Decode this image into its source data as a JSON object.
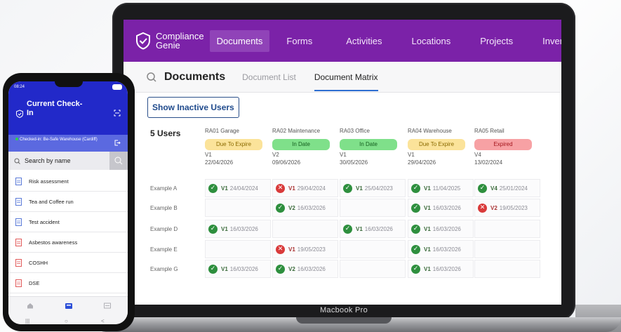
{
  "laptop": {
    "model_label": "Macbook Pro"
  },
  "app": {
    "brand": {
      "line1": "Compliance",
      "line2": "Genie"
    },
    "nav": [
      {
        "label": "Documents",
        "active": true
      },
      {
        "label": "Forms",
        "active": false
      },
      {
        "label": "Activities",
        "active": false
      },
      {
        "label": "Locations",
        "active": false
      },
      {
        "label": "Projects",
        "active": false
      },
      {
        "label": "Inventory",
        "active": false
      }
    ],
    "subheader": {
      "title": "Documents",
      "tabs": [
        {
          "label": "Document List",
          "active": false
        },
        {
          "label": "Document Matrix",
          "active": true
        }
      ]
    },
    "show_inactive_label": "Show Inactive Users",
    "users_count": "5 Users",
    "columns": [
      {
        "name": "RA01 Garage",
        "status": "Due To Expire",
        "status_kind": "expire",
        "version": "V1",
        "date": "22/04/2026"
      },
      {
        "name": "RA02 Maintenance",
        "status": "In Date",
        "status_kind": "indate",
        "version": "V2",
        "date": "09/06/2026"
      },
      {
        "name": "RA03 Office",
        "status": "In Date",
        "status_kind": "indate",
        "version": "V1",
        "date": "30/05/2026"
      },
      {
        "name": "RA04 Warehouse",
        "status": "Due To Expire",
        "status_kind": "expire",
        "version": "V1",
        "date": "29/04/2026"
      },
      {
        "name": "RA05 Retail",
        "status": "Expired",
        "status_kind": "expired",
        "version": "V4",
        "date": "13/02/2024"
      }
    ],
    "rows": [
      {
        "label": "Example A",
        "cells": [
          {
            "ok": true,
            "version": "V1",
            "date": "24/04/2024"
          },
          {
            "ok": false,
            "version": "V1",
            "date": "29/04/2024"
          },
          {
            "ok": true,
            "version": "V1",
            "date": "25/04/2023"
          },
          {
            "ok": true,
            "version": "V1",
            "date": "11/04/2025"
          },
          {
            "ok": true,
            "version": "V4",
            "date": "25/01/2024"
          }
        ]
      },
      {
        "label": "Example B",
        "cells": [
          null,
          {
            "ok": true,
            "version": "V2",
            "date": "16/03/2026"
          },
          null,
          {
            "ok": true,
            "version": "V1",
            "date": "16/03/2026"
          },
          {
            "ok": false,
            "version": "V2",
            "date": "19/05/2023"
          }
        ]
      },
      {
        "label": "Example D",
        "cells": [
          {
            "ok": true,
            "version": "V1",
            "date": "16/03/2026"
          },
          null,
          {
            "ok": true,
            "version": "V1",
            "date": "16/03/2026"
          },
          {
            "ok": true,
            "version": "V1",
            "date": "16/03/2026"
          },
          null
        ]
      },
      {
        "label": "Example E",
        "cells": [
          null,
          {
            "ok": false,
            "version": "V1",
            "date": "19/05/2023"
          },
          null,
          {
            "ok": true,
            "version": "V1",
            "date": "16/03/2026"
          },
          null
        ]
      },
      {
        "label": "Example G",
        "cells": [
          {
            "ok": true,
            "version": "V1",
            "date": "16/03/2026"
          },
          {
            "ok": true,
            "version": "V2",
            "date": "16/03/2026"
          },
          null,
          {
            "ok": true,
            "version": "V1",
            "date": "16/03/2026"
          },
          null
        ]
      }
    ]
  },
  "phone": {
    "time": "08:24",
    "title": "Current Check-In",
    "checkin_text": "Checked-in:  Be-Safe Warehouse (Cardiff)",
    "search_placeholder": "Search by name",
    "items": [
      {
        "label": "Risk assessment",
        "icon": "document-icon"
      },
      {
        "label": "Tea and Coffee run",
        "icon": "document-icon"
      },
      {
        "label": "Test accident",
        "icon": "document-icon"
      },
      {
        "label": "Asbestos awareness",
        "icon": "pdf-icon"
      },
      {
        "label": "COSHH",
        "icon": "pdf-icon"
      },
      {
        "label": "DSE",
        "icon": "pdf-icon"
      }
    ],
    "colors": {
      "header": "#2229c9",
      "checkin": "#5b69e0"
    }
  },
  "colors": {
    "nav": "#7b22a8",
    "ok": "#2e8f3e",
    "bad": "#d93a3a"
  }
}
